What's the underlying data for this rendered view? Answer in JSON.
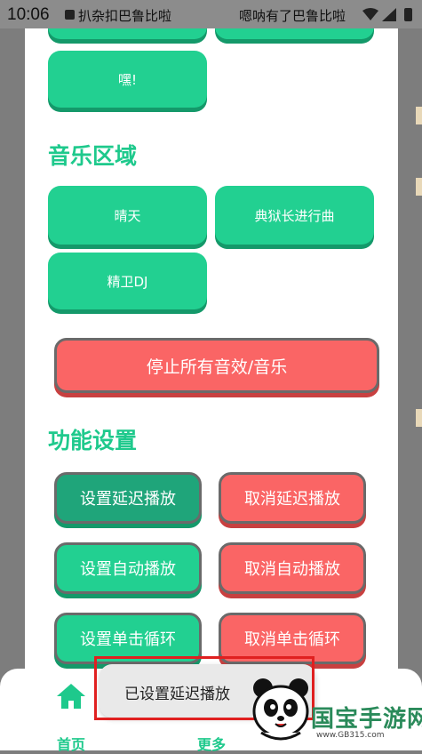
{
  "status_bar": {
    "time": "10:06",
    "notification_1": "扒杂扣巴鲁比啦",
    "notification_2": "嗯呐有了巴鲁比啦"
  },
  "sound_buttons": [
    {
      "label": ""
    },
    {
      "label": ""
    },
    {
      "label": "嘿!"
    }
  ],
  "music_section": {
    "title": "音乐区域",
    "buttons": [
      {
        "label": "晴天"
      },
      {
        "label": "典狱长进行曲"
      },
      {
        "label": "精卫DJ"
      }
    ]
  },
  "stop_button": {
    "label": "停止所有音效/音乐"
  },
  "function_section": {
    "title": "功能设置",
    "buttons": [
      {
        "label": "设置延迟播放"
      },
      {
        "label": "取消延迟播放"
      },
      {
        "label": "设置自动播放"
      },
      {
        "label": "取消自动播放"
      },
      {
        "label": "设置单击循环"
      },
      {
        "label": "取消单击循环"
      }
    ]
  },
  "bottom_nav": {
    "home_label": "首页",
    "more_label": "更多"
  },
  "toast": {
    "text": "已设置延迟播放"
  },
  "watermark": {
    "title": "国宝手游网",
    "url": "www.GB315.com"
  },
  "colors": {
    "accent_green": "#22d091",
    "danger_red": "#fa6565",
    "title_green": "#1ec98c",
    "highlight_red": "#e02020"
  }
}
